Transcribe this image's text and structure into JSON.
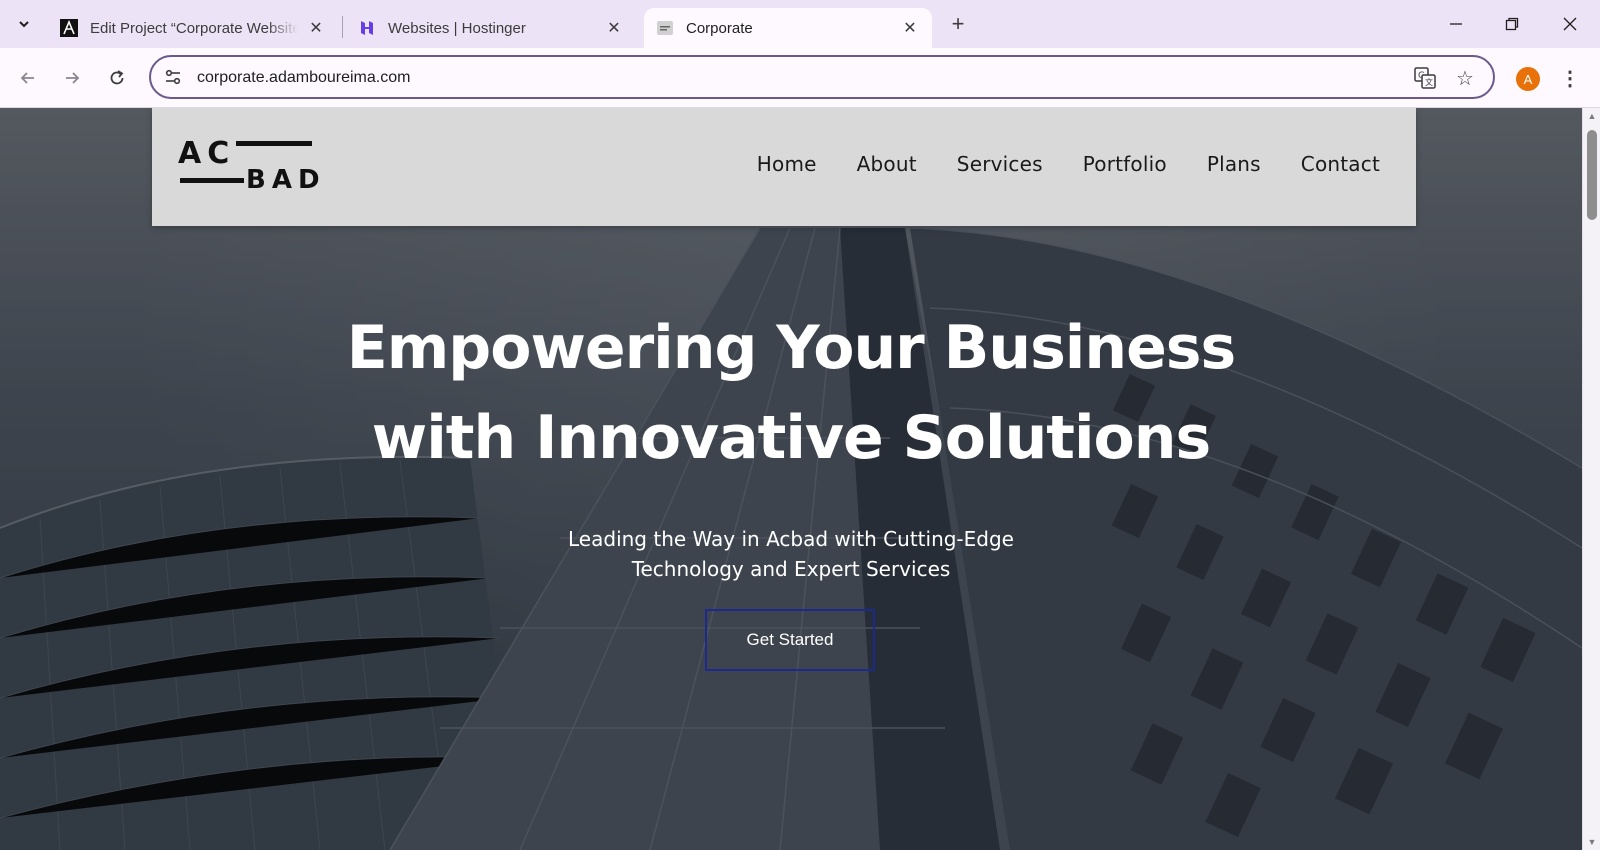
{
  "browser": {
    "tabs": [
      {
        "title": "Edit Project “Corporate Website",
        "favicon": "astra-logo-icon",
        "active": false
      },
      {
        "title": "Websites | Hostinger",
        "favicon": "hostinger-logo-icon",
        "active": false
      },
      {
        "title": "Corporate",
        "favicon": "site-favicon-icon",
        "active": true
      }
    ],
    "url": "corporate.adamboureima.com",
    "profile_initial": "A",
    "colors": {
      "accent": "#6a5a8c",
      "avatar": "#e8710a",
      "tabstrip": "#ece3f6"
    }
  },
  "site": {
    "logo": {
      "top": "AC",
      "bottom": "BAD"
    },
    "nav": [
      "Home",
      "About",
      "Services",
      "Portfolio",
      "Plans",
      "Contact"
    ],
    "hero": {
      "title_line1": "Empowering Your Business",
      "title_line2": "with Innovative Solutions",
      "subtitle_line1": "Leading the Way in Acbad with Cutting-Edge",
      "subtitle_line2": "Technology and Expert Services",
      "cta": "Get Started"
    },
    "colors": {
      "header_bg": "#d9d9d9",
      "cta_border": "#1b2a8c"
    }
  }
}
